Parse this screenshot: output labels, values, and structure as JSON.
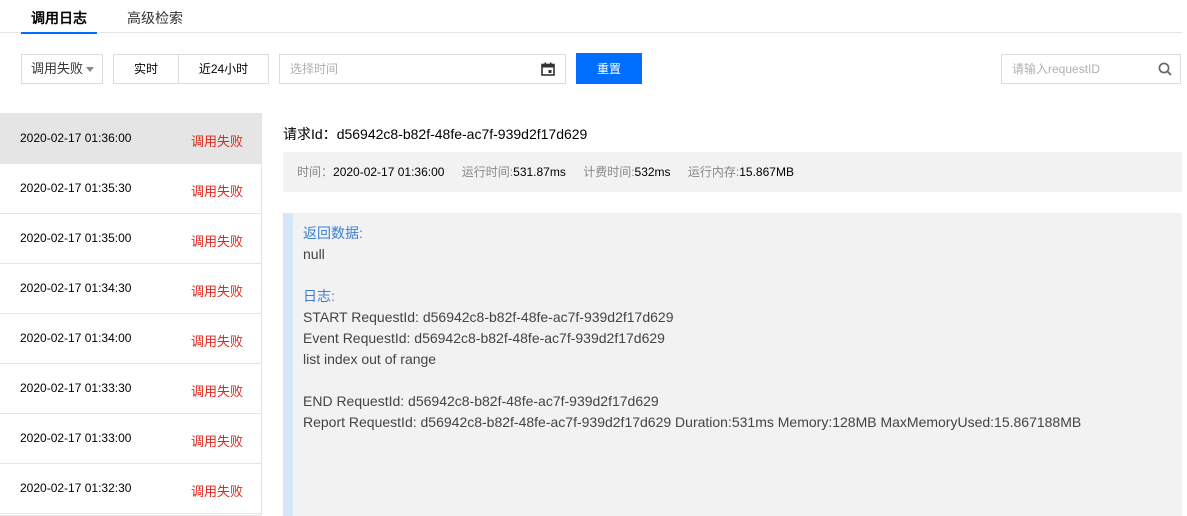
{
  "tabs": [
    {
      "label": "调用日志"
    },
    {
      "label": "高级检索"
    }
  ],
  "toolbar": {
    "status_filter": "调用失败",
    "realtime_label": "实时",
    "last24h_label": "近24小时",
    "date_placeholder": "选择时间",
    "reset_label": "重置",
    "search_placeholder": "请输入requestID"
  },
  "log_list": [
    {
      "time": "2020-02-17 01:36:00",
      "status": "调用失败"
    },
    {
      "time": "2020-02-17 01:35:30",
      "status": "调用失败"
    },
    {
      "time": "2020-02-17 01:35:00",
      "status": "调用失败"
    },
    {
      "time": "2020-02-17 01:34:30",
      "status": "调用失败"
    },
    {
      "time": "2020-02-17 01:34:00",
      "status": "调用失败"
    },
    {
      "time": "2020-02-17 01:33:30",
      "status": "调用失败"
    },
    {
      "time": "2020-02-17 01:33:00",
      "status": "调用失败"
    },
    {
      "time": "2020-02-17 01:32:30",
      "status": "调用失败"
    }
  ],
  "detail": {
    "request_label": "请求Id：",
    "request_id": "d56942c8-b82f-48fe-ac7f-939d2f17d629",
    "time_label": "时间：",
    "time_value": "2020-02-17 01:36:00",
    "run_label": "运行时间:",
    "run_value": "531.87ms",
    "bill_label": "计费时间:",
    "bill_value": "532ms",
    "mem_label": "运行内存:",
    "mem_value": "15.867MB",
    "return_label": "返回数据:",
    "return_value": "null",
    "log_label": "日志:",
    "log_lines": [
      "START RequestId: d56942c8-b82f-48fe-ac7f-939d2f17d629",
      "Event RequestId: d56942c8-b82f-48fe-ac7f-939d2f17d629",
      "list index out of range",
      "",
      "END RequestId: d56942c8-b82f-48fe-ac7f-939d2f17d629",
      "Report RequestId: d56942c8-b82f-48fe-ac7f-939d2f17d629 Duration:531ms Memory:128MB MaxMemoryUsed:15.867188MB"
    ]
  },
  "colors": {
    "accent": "#006eff",
    "error": "#e1261c",
    "label_blue": "#3c7fd1"
  },
  "icons": {
    "calendar": "calendar-icon",
    "search": "search-icon",
    "dropdown": "chevron-down-icon"
  }
}
